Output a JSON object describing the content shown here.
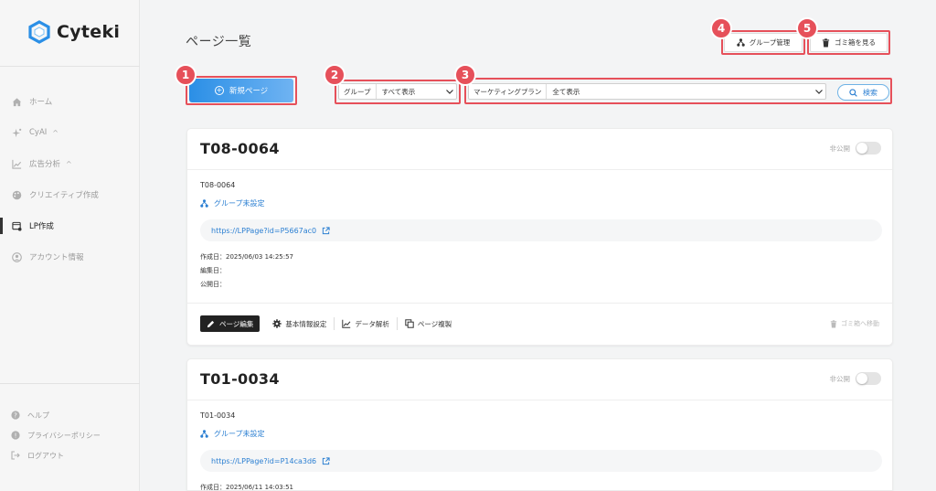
{
  "brand": {
    "name": "Cyteki",
    "color": "#2b7fd2"
  },
  "sidebar": {
    "items": [
      {
        "label": "ホーム",
        "icon": "home-icon"
      },
      {
        "label": "CyAI",
        "icon": "sparkle-icon",
        "expand": "^"
      },
      {
        "label": "広告分析",
        "icon": "chart-icon",
        "expand": "^"
      },
      {
        "label": "クリエイティブ作成",
        "icon": "palette-icon"
      },
      {
        "label": "LP作成",
        "icon": "lp-icon",
        "active": true
      },
      {
        "label": "アカウント情報",
        "icon": "user-icon"
      }
    ],
    "bottom": [
      {
        "label": "ヘルプ",
        "icon": "help-icon"
      },
      {
        "label": "プライバシーポリシー",
        "icon": "info-icon"
      },
      {
        "label": "ログアウト",
        "icon": "logout-icon"
      }
    ]
  },
  "header": {
    "title": "ページ一覧",
    "group_manage_label": "グループ管理",
    "trash_label": "ゴミ箱を見る"
  },
  "toolbar": {
    "new_page_label": "新規ページ",
    "group_filter": {
      "label": "グループ",
      "value": "すべて表示"
    },
    "plan_filter": {
      "label": "マーケティングプラン",
      "value": "全て表示"
    },
    "search_label": "検索"
  },
  "annotations": [
    "1",
    "2",
    "3",
    "4",
    "5"
  ],
  "cards": [
    {
      "title": "T08-0064",
      "visibility": "非公開",
      "subtitle": "T08-0064",
      "group": "グループ未設定",
      "url": "https://LPPage?id=P5667ac0",
      "created": "作成日：2025/06/03 14:25:57",
      "edited": "編集日：",
      "published": "公開日：",
      "actions": {
        "edit": "ページ編集",
        "settings": "基本情報設定",
        "analytics": "データ解析",
        "duplicate": "ページ複製",
        "trash": "ゴミ箱へ移動"
      }
    },
    {
      "title": "T01-0034",
      "visibility": "非公開",
      "subtitle": "T01-0034",
      "group": "グループ未設定",
      "url": "https://LPPage?id=P14ca3d6",
      "created": "作成日：2025/06/11 14:03:51"
    }
  ]
}
